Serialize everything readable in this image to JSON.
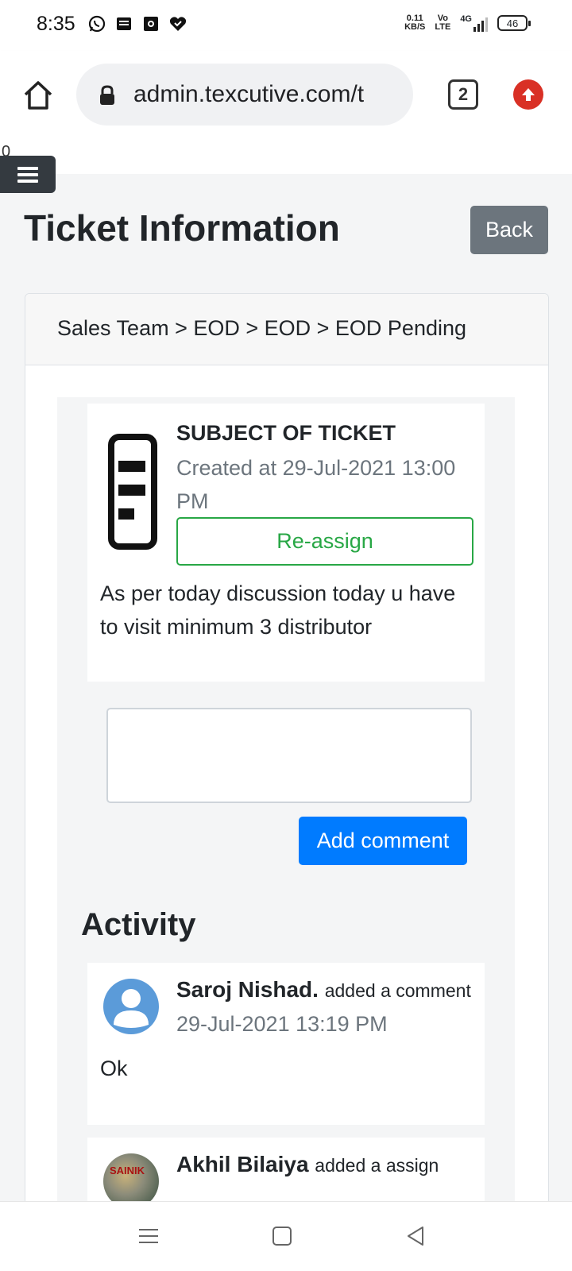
{
  "status_bar": {
    "time": "8:35",
    "net_speed_value": "0.11",
    "net_speed_unit": "KB/S",
    "volte_top": "Vo",
    "volte_bottom": "LTE",
    "network": "4G",
    "battery": "46"
  },
  "browser": {
    "url": "admin.texcutive.com/t",
    "tab_count": "2"
  },
  "page": {
    "stray_char": "0",
    "title": "Ticket Information",
    "back_label": "Back",
    "breadcrumb": "Sales Team > EOD > EOD > EOD Pending"
  },
  "ticket": {
    "subject": "SUBJECT OF TICKET",
    "created": "Created at 29-Jul-2021 13:00 PM",
    "reassign_label": "Re-assign",
    "description": "As per today discussion today u have to visit minimum 3 distributor"
  },
  "comment_form": {
    "value": "",
    "placeholder": "",
    "submit_label": "Add comment"
  },
  "activity": {
    "title": "Activity",
    "items": [
      {
        "name": "Saroj Nishad.",
        "action": "added a comment",
        "time": "29-Jul-2021 13:19 PM",
        "text": "Ok"
      },
      {
        "name": "Akhil Bilaiya",
        "action": "added a assign",
        "avatar_text": "SAINIK"
      }
    ]
  },
  "colors": {
    "success": "#28a745",
    "primary": "#007bff",
    "secondary": "#6c757d",
    "dark": "#343a40"
  }
}
